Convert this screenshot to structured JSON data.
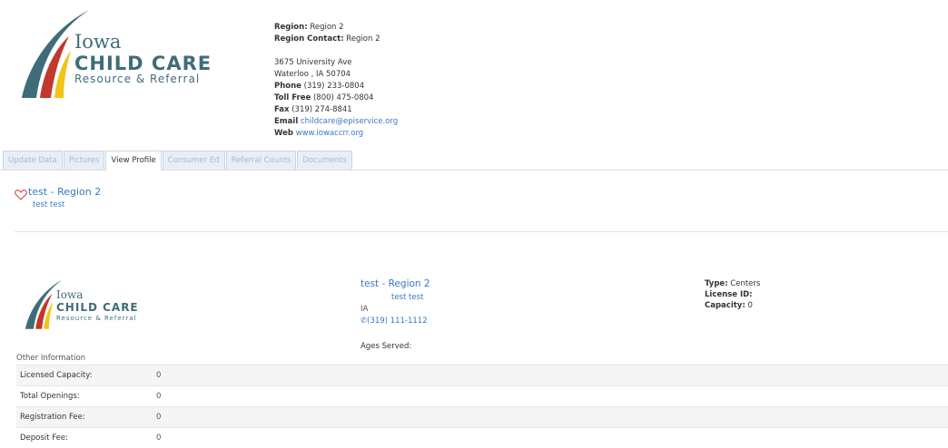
{
  "header": {
    "logo": {
      "word1": "Iowa",
      "word2": "CHILD CARE",
      "word3": "Resource & Referral",
      "colors": {
        "teal": "#3f6c78",
        "red": "#c0392b",
        "yellow": "#f0c419"
      }
    },
    "contact": {
      "region_label": "Region:",
      "region_value": "Region 2",
      "region_contact_label": "Region Contact:",
      "region_contact_value": "Region 2",
      "address1": "3675 University Ave",
      "address2": "Waterloo , IA 50704",
      "phone_label": "Phone",
      "phone_value": "(319) 233-0804",
      "tollfree_label": "Toll Free",
      "tollfree_value": "(800) 475-0804",
      "fax_label": "Fax",
      "fax_value": "(319) 274-8841",
      "email_label": "Email",
      "email_value": "childcare@episervice.org",
      "web_label": "Web",
      "web_value": "www.iowaccrr.org"
    }
  },
  "tabs": [
    {
      "label": "Update Data",
      "active": false
    },
    {
      "label": "Pictures",
      "active": false
    },
    {
      "label": "View Profile",
      "active": true
    },
    {
      "label": "Consumer Ed",
      "active": false
    },
    {
      "label": "Referral Counts",
      "active": false
    },
    {
      "label": "Documents",
      "active": false
    }
  ],
  "profile_header": {
    "favorite_icon": "heart-outline-icon",
    "title": "test - Region 2",
    "subtitle": "test test"
  },
  "profile_card": {
    "logo": {
      "word1": "Iowa",
      "word2": "CHILD CARE",
      "word3": "Resource & Referral"
    },
    "name": "test - Region 2",
    "contact_name": "test test",
    "state": "IA",
    "phone_icon": "phone-icon",
    "phone": "(319) 111-1112",
    "ages_served_label": "Ages Served:",
    "type_label": "Type:",
    "type_value": "Centers",
    "license_label": "License ID:",
    "license_value": "",
    "capacity_label": "Capacity:",
    "capacity_value": "0"
  },
  "other_information": {
    "heading": "Other Information",
    "rows": [
      {
        "label": "Licensed Capacity:",
        "value": "0"
      },
      {
        "label": "Total Openings:",
        "value": "0"
      },
      {
        "label": "Registration Fee:",
        "value": "0"
      },
      {
        "label": "Deposit Fee:",
        "value": "0"
      }
    ]
  }
}
